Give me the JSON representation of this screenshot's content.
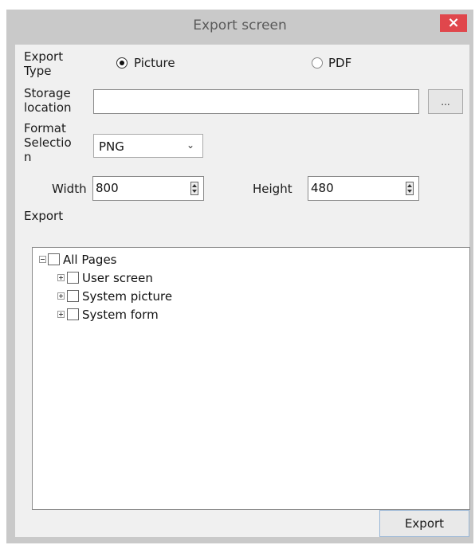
{
  "window": {
    "title": "Export screen",
    "close_glyph": "×"
  },
  "export_type": {
    "label_line1": "Export",
    "label_line2": "Type",
    "options": [
      {
        "label": "Picture",
        "selected": true
      },
      {
        "label": "PDF",
        "selected": false
      }
    ]
  },
  "storage": {
    "label_line1": "Storage",
    "label_line2": "location",
    "value": "",
    "browse_label": "..."
  },
  "format": {
    "label_line1": "Format",
    "label_line2": "Selectio",
    "label_line3": "n",
    "selected": "PNG"
  },
  "size": {
    "width_label": "Width",
    "width_value": "800",
    "height_label": "Height",
    "height_value": "480"
  },
  "export_section": {
    "label": "Export",
    "tree": {
      "root": "All Pages",
      "children": [
        "User screen",
        "System picture",
        "System form"
      ]
    }
  },
  "footer": {
    "export_button": "Export"
  }
}
